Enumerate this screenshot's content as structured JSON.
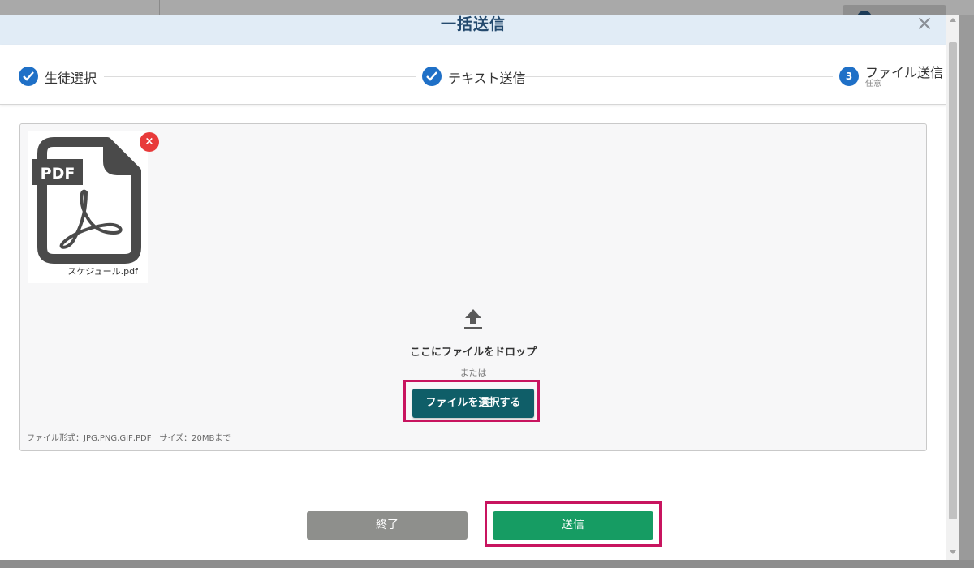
{
  "modal": {
    "title": "一括送信",
    "close_label": "×"
  },
  "stepper": {
    "steps": [
      {
        "label": "生徒選択",
        "status": "completed"
      },
      {
        "label": "テキスト送信",
        "status": "completed"
      },
      {
        "label": "ファイル送信",
        "sub": "任意",
        "number": "3",
        "status": "current"
      }
    ]
  },
  "dropzone": {
    "file": {
      "name": "スケジュール.pdf",
      "badge": "PDF"
    },
    "remove_label": "×",
    "drop_text": "ここにファイルをドロップ",
    "or_text": "または",
    "select_button": "ファイルを選択する",
    "file_info": "ファイル形式：JPG,PNG,GIF,PDF　サイズ：20MBまで"
  },
  "footer": {
    "end_button": "終了",
    "send_button": "送信"
  },
  "colors": {
    "step_active": "#1f70c7",
    "select_button": "#0f5e68",
    "send_button": "#169c63",
    "end_button": "#8e8f8c",
    "highlight": "#c8145f",
    "remove": "#e83a3a"
  }
}
